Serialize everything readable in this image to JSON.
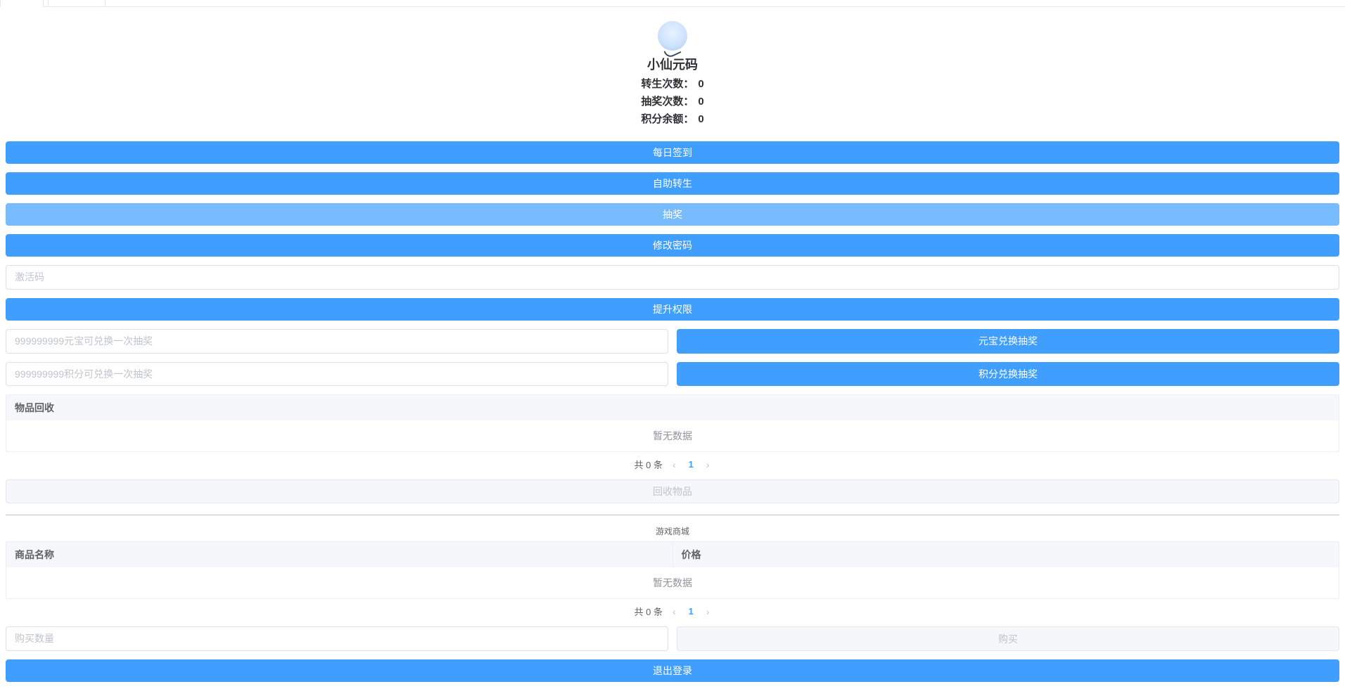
{
  "profile": {
    "name": "小仙元码",
    "stats": {
      "reborn_label": "转生次数：",
      "reborn_value": "0",
      "lottery_label": "抽奖次数：",
      "lottery_value": "0",
      "points_label": "积分余额：",
      "points_value": "0"
    }
  },
  "buttons": {
    "daily_checkin": "每日签到",
    "self_reborn": "自助转生",
    "lottery": "抽奖",
    "change_password": "修改密码",
    "upgrade_privilege": "提升权限",
    "yuanbao_exchange": "元宝兑换抽奖",
    "points_exchange": "积分兑换抽奖",
    "recycle_items": "回收物品",
    "buy": "购买",
    "logout": "退出登录"
  },
  "inputs": {
    "activation_code_placeholder": "激活码",
    "yuanbao_placeholder": "999999999元宝可兑换一次抽奖",
    "points_placeholder": "999999999积分可兑换一次抽奖",
    "buy_qty_placeholder": "购买数量"
  },
  "recycle_table": {
    "col1": "物品回收",
    "empty_text": "暂无数据",
    "total_prefix": "共",
    "total_count": "0",
    "total_suffix": "条",
    "current_page": "1"
  },
  "shop_section_title": "游戏商城",
  "shop_table": {
    "col1": "商品名称",
    "col2": "价格",
    "empty_text": "暂无数据",
    "total_prefix": "共",
    "total_count": "0",
    "total_suffix": "条",
    "current_page": "1"
  }
}
